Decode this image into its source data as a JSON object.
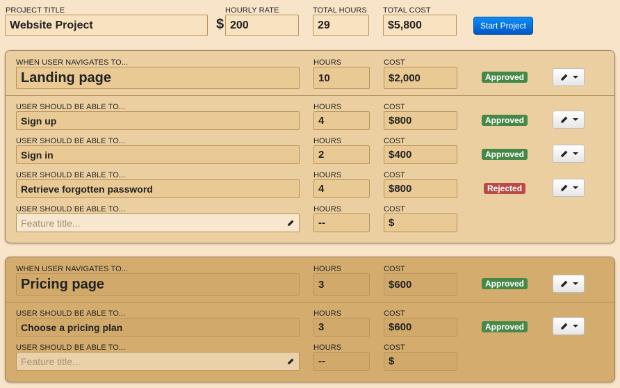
{
  "header": {
    "project_title_label": "PROJECT TITLE",
    "project_title_value": "Website Project",
    "hourly_rate_label": "HOURLY RATE",
    "currency_symbol": "$",
    "hourly_rate_value": "200",
    "total_hours_label": "TOTAL HOURS",
    "total_hours_value": "29",
    "total_cost_label": "TOTAL COST",
    "total_cost_value": "$5,800",
    "start_button_label": "Start Project"
  },
  "labels": {
    "section": "WHEN USER NAVIGATES TO...",
    "feature": "USER SHOULD BE ABLE TO...",
    "hours": "HOURS",
    "cost": "COST",
    "feature_placeholder": "Feature title...",
    "empty_hours": "--",
    "empty_cost": "$"
  },
  "sections": [
    {
      "title": "Landing page",
      "hours": "10",
      "cost": "$2,000",
      "status": "Approved",
      "features": [
        {
          "title": "Sign up",
          "hours": "4",
          "cost": "$800",
          "status": "Approved"
        },
        {
          "title": "Sign in",
          "hours": "2",
          "cost": "$400",
          "status": "Approved"
        },
        {
          "title": "Retrieve forgotten password",
          "hours": "4",
          "cost": "$800",
          "status": "Rejected"
        }
      ]
    },
    {
      "title": "Pricing page",
      "hours": "3",
      "cost": "$600",
      "status": "Approved",
      "features": [
        {
          "title": "Choose a pricing plan",
          "hours": "3",
          "cost": "$600",
          "status": "Approved"
        }
      ]
    }
  ],
  "colors": {
    "approved": "#468847",
    "rejected": "#b94a48",
    "primary_button": "#0d6fe0",
    "background": "#f8e5c9"
  },
  "icons": {
    "edit": "pencil-icon",
    "dropdown": "caret-down-icon"
  }
}
